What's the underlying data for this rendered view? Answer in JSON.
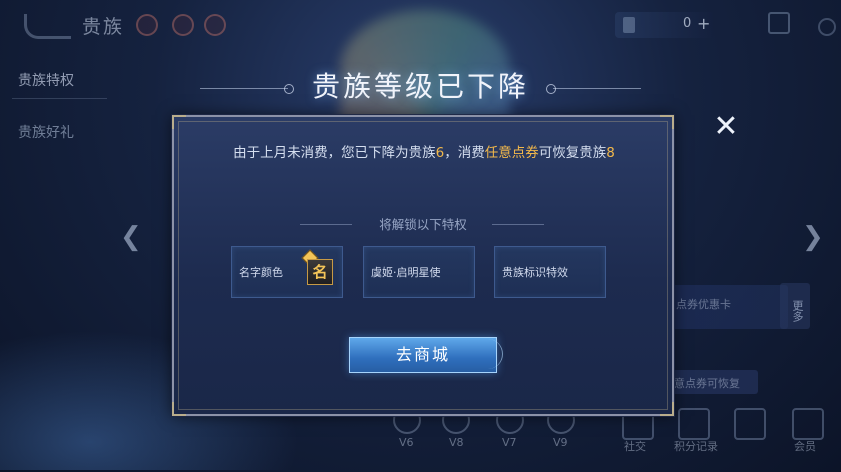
{
  "topbar": {
    "title": "贵族",
    "currency_value": "0",
    "currency_plus": "+"
  },
  "sidebar": {
    "items": [
      {
        "label": "贵族特权"
      },
      {
        "label": "贵族好礼"
      }
    ]
  },
  "background": {
    "card_label": "点券优惠卡",
    "more_label": "更多",
    "banner_label": "意点券可恢复",
    "vip_labels": [
      "V6",
      "V8",
      "V7",
      "V9"
    ],
    "bottom_labels": [
      "社交",
      "积分记录",
      "",
      "会员"
    ]
  },
  "dialog": {
    "title": "贵族等级已下降",
    "message_part1": "由于上月未消费，您已下降为贵族",
    "current_level": "6",
    "message_part2": "，消费",
    "highlight": "任意点券",
    "message_part3": "可恢复贵族",
    "restore_level": "8",
    "unlock_label": "将解锁以下特权",
    "privileges": [
      {
        "label": "名字颜色",
        "badge": "名"
      },
      {
        "label": "虞姬·启明星使"
      },
      {
        "label": "贵族标识特效"
      }
    ],
    "shop_button": "去商城",
    "close_symbol": "✕"
  },
  "colors": {
    "highlight": "#f2b84b",
    "button": "#2f6fbd",
    "dialog_bg": "#1d2b4f"
  },
  "icons": {
    "back": "back-arrow-icon",
    "close": "close-icon",
    "left_nav": "chevron-left-icon",
    "right_nav": "chevron-right-icon"
  }
}
